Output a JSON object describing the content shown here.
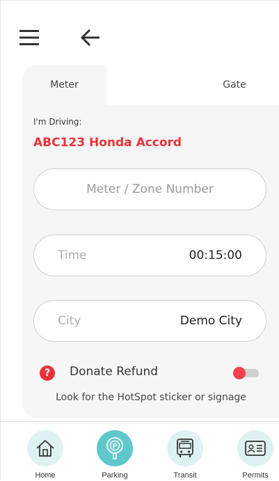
{
  "toolbar": {
    "menu_icon": "hamburger-menu-icon",
    "back_icon": "arrow-left-icon"
  },
  "tabs": [
    {
      "label": "Meter",
      "selected": true
    },
    {
      "label": "Gate",
      "selected": false
    }
  ],
  "form": {
    "driving_label": "I'm Driving:",
    "vehicle": "ABC123 Honda Accord",
    "zone": {
      "placeholder": "Meter / Zone Number",
      "value": ""
    },
    "time": {
      "label": "Time",
      "value": "00:15:00"
    },
    "city": {
      "label": "City",
      "value": "Demo City"
    },
    "donate": {
      "label": "Donate Refund",
      "icon": "question-icon",
      "enabled": false
    },
    "hint": "Look for the HotSpot sticker or signage"
  },
  "nav": [
    {
      "label": "Home",
      "icon": "home-icon",
      "active": false
    },
    {
      "label": "Parking",
      "icon": "parking-meter-icon",
      "active": true
    },
    {
      "label": "Transit",
      "icon": "bus-icon",
      "active": false
    },
    {
      "label": "Permits",
      "icon": "id-card-icon",
      "active": false
    }
  ],
  "colors": {
    "accent_red": "#e8333c",
    "nav_active": "#5ec8cb",
    "nav_inactive": "#dff2f3",
    "card_bg": "#f6f6f6"
  }
}
